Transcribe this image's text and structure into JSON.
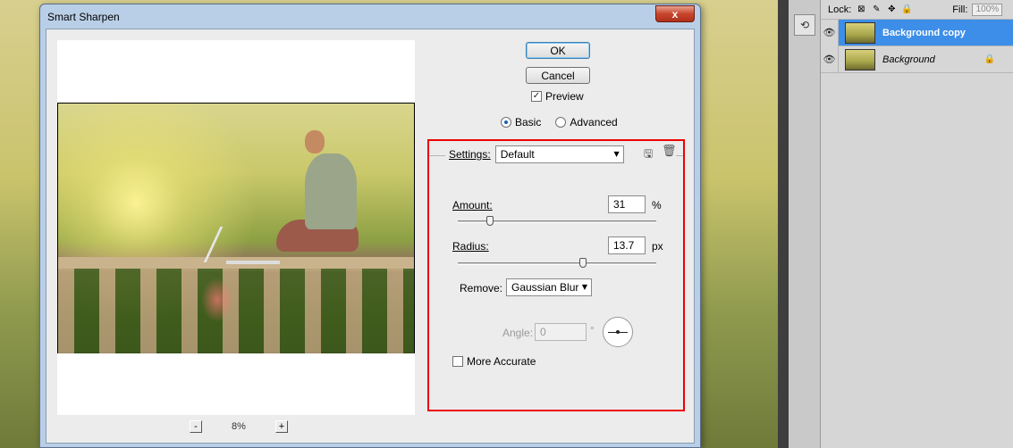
{
  "dialog": {
    "title": "Smart Sharpen",
    "close_label": "x",
    "ok_label": "OK",
    "cancel_label": "Cancel",
    "preview_label": "Preview",
    "preview_checked": true,
    "mode_basic_label": "Basic",
    "mode_advanced_label": "Advanced",
    "mode_selected": "Basic",
    "zoom": {
      "minus_label": "-",
      "plus_label": "+",
      "value": "8%"
    },
    "settings": {
      "label": "Settings:",
      "value": "Default",
      "save_icon": "save-settings-icon",
      "delete_icon": "trash-icon"
    },
    "amount": {
      "label": "Amount:",
      "value": "31",
      "unit": "%",
      "slider_fraction": 0.09
    },
    "radius": {
      "label": "Radius:",
      "value": "13.7",
      "unit": "px",
      "slider_fraction": 0.63
    },
    "remove": {
      "label": "Remove:",
      "value": "Gaussian Blur"
    },
    "angle": {
      "label": "Angle:",
      "value": "0",
      "unit": "°"
    },
    "more_accurate_label": "More Accurate",
    "more_accurate_checked": false,
    "highlight_color": "#e00000"
  },
  "layers_panel": {
    "lock_label": "Lock:",
    "fill_label": "Fill:",
    "fill_value": "100%",
    "layers": [
      {
        "name": "Background copy",
        "selected": true,
        "visible": true
      },
      {
        "name": "Background",
        "selected": false,
        "visible": true,
        "locked": true
      }
    ],
    "selected_color": "#3d8ee8"
  }
}
